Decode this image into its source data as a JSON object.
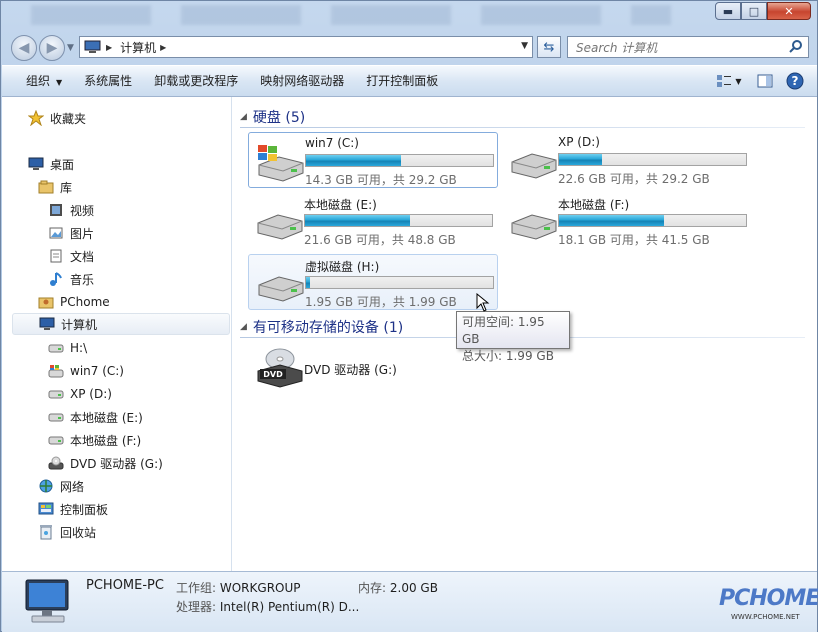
{
  "window": {
    "caption": {
      "min": "▬",
      "max": "□",
      "close": "✕"
    }
  },
  "address": {
    "crumb": "计算机",
    "search_placeholder": "Search 计算机"
  },
  "toolbar": {
    "organize": "组织",
    "system_properties": "系统属性",
    "uninstall": "卸载或更改程序",
    "map_drive": "映射网络驱动器",
    "control_panel": "打开控制面板"
  },
  "nav": [
    {
      "label": "收藏夹",
      "icon": "star-icon"
    },
    {
      "label": "桌面",
      "icon": "desktop-icon"
    },
    {
      "label": "库",
      "icon": "library-icon"
    },
    {
      "label": "视频",
      "icon": "video-icon"
    },
    {
      "label": "图片",
      "icon": "picture-icon"
    },
    {
      "label": "文档",
      "icon": "document-icon"
    },
    {
      "label": "音乐",
      "icon": "music-icon"
    },
    {
      "label": "PChome",
      "icon": "user-folder-icon"
    },
    {
      "label": "计算机",
      "icon": "computer-icon"
    },
    {
      "label": "H:\\",
      "icon": "drive-icon"
    },
    {
      "label": "win7 (C:)",
      "icon": "windows-drive-icon"
    },
    {
      "label": "XP (D:)",
      "icon": "drive-icon"
    },
    {
      "label": "本地磁盘 (E:)",
      "icon": "drive-icon"
    },
    {
      "label": "本地磁盘 (F:)",
      "icon": "drive-icon"
    },
    {
      "label": "DVD 驱动器 (G:)",
      "icon": "dvd-icon"
    },
    {
      "label": "网络",
      "icon": "network-icon"
    },
    {
      "label": "控制面板",
      "icon": "control-panel-icon"
    },
    {
      "label": "回收站",
      "icon": "recycle-bin-icon"
    }
  ],
  "groups": {
    "hard_disks": "硬盘 (5)",
    "removable": "有可移动存储的设备 (1)"
  },
  "drives": [
    {
      "name": "win7 (C:)",
      "free_text": "14.3 GB 可用，共 29.2 GB",
      "used_fraction": 0.51,
      "icon": "windows-drive-icon"
    },
    {
      "name": "XP (D:)",
      "free_text": "22.6 GB 可用，共 29.2 GB",
      "used_fraction": 0.23,
      "icon": "drive-icon"
    },
    {
      "name": "本地磁盘 (E:)",
      "free_text": "21.6 GB 可用，共 48.8 GB",
      "used_fraction": 0.56,
      "icon": "drive-icon"
    },
    {
      "name": "本地磁盘 (F:)",
      "free_text": "18.1 GB 可用，共 41.5 GB",
      "used_fraction": 0.56,
      "icon": "drive-icon"
    },
    {
      "name": "虚拟磁盘 (H:)",
      "free_text": "1.95 GB 可用，共 1.99 GB",
      "used_fraction": 0.02,
      "icon": "drive-icon"
    }
  ],
  "dvd": {
    "name": "DVD 驱动器 (G:)",
    "badge": "DVD"
  },
  "tooltip": {
    "line1": "可用空间: 1.95 GB",
    "line2": "总大小: 1.99 GB"
  },
  "details": {
    "pc_name": "PCHOME-PC",
    "workgroup_label": "工作组:",
    "workgroup": "WORKGROUP",
    "memory_label": "内存:",
    "memory": "2.00 GB",
    "cpu_label": "处理器:",
    "cpu": "Intel(R) Pentium(R) D..."
  },
  "watermark": {
    "brand": "PCHOME",
    "site": "WWW.PCHOME.NET"
  },
  "colors": {
    "bar_fill": "#27a6d8",
    "group_heading": "#1e3287",
    "selection_border": "#84acdd"
  }
}
